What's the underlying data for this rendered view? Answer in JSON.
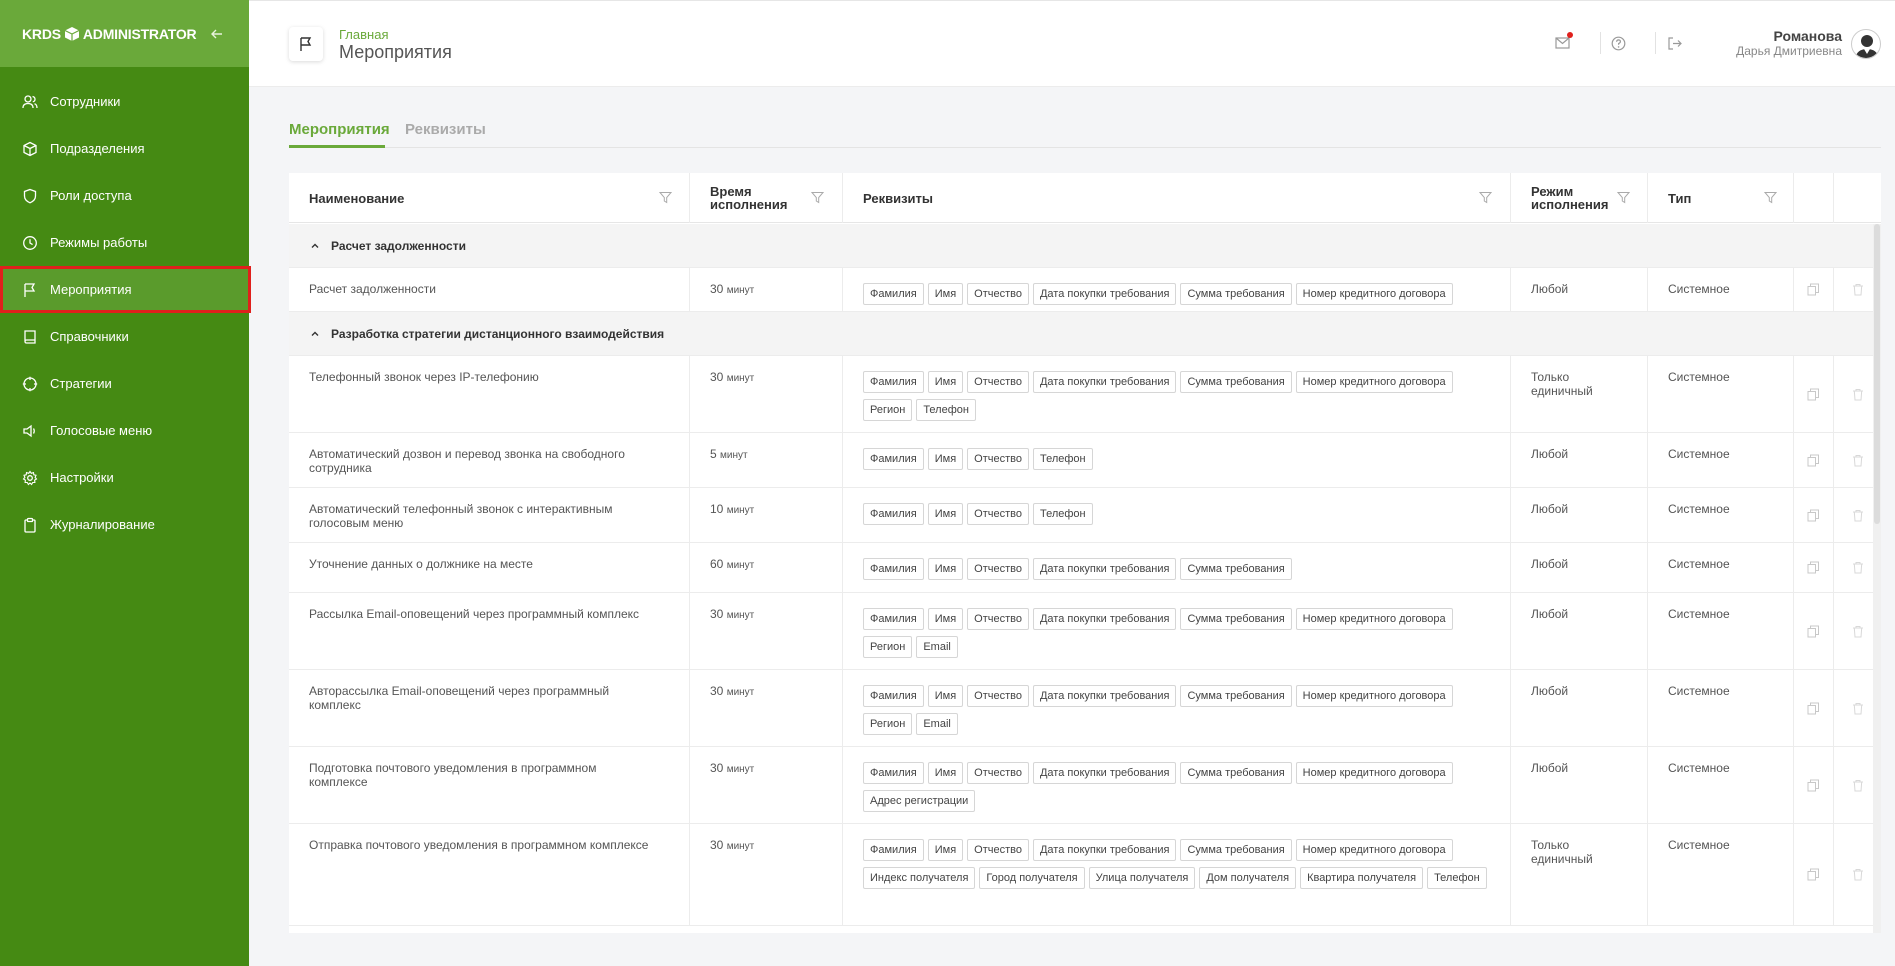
{
  "sidebar": {
    "logo_left": "KRDS",
    "logo_right": "ADMINISTRATOR",
    "items": [
      {
        "label": "Сотрудники",
        "icon": "users-icon"
      },
      {
        "label": "Подразделения",
        "icon": "cube-icon"
      },
      {
        "label": "Роли доступа",
        "icon": "shield-icon"
      },
      {
        "label": "Режимы работы",
        "icon": "clock-icon"
      },
      {
        "label": "Мероприятия",
        "icon": "flag-icon",
        "active": true
      },
      {
        "label": "Справочники",
        "icon": "book-icon"
      },
      {
        "label": "Стратегии",
        "icon": "crosshair-icon"
      },
      {
        "label": "Голосовые меню",
        "icon": "speaker-icon"
      },
      {
        "label": "Настройки",
        "icon": "gear-icon"
      },
      {
        "label": "Журналирование",
        "icon": "clipboard-icon"
      }
    ]
  },
  "header": {
    "breadcrumb": "Главная",
    "title": "Мероприятия",
    "user": {
      "last_name": "Романова",
      "first_names": "Дарья Дмитриевна"
    }
  },
  "tabs": [
    {
      "label": "Мероприятия",
      "active": true
    },
    {
      "label": "Реквизиты",
      "active": false
    }
  ],
  "table": {
    "columns": {
      "name": "Наименование",
      "time_l1": "Время",
      "time_l2": "исполнения",
      "req": "Реквизиты",
      "mode_l1": "Режим",
      "mode_l2": "исполнения",
      "type": "Тип"
    },
    "groups": [
      {
        "title": "Расчет задолженности",
        "rows": [
          {
            "name": [
              "Расчет задолженности"
            ],
            "time": "30",
            "unit": "минут",
            "req": [
              "Фамилия",
              "Имя",
              "Отчество",
              "Дата покупки требования",
              "Сумма требования",
              "Номер кредитного договора"
            ],
            "mode": [
              "Любой"
            ],
            "type": "Системное"
          }
        ]
      },
      {
        "title": "Разработка стратегии дистанционного взаимодействия",
        "rows": [
          {
            "name": [
              "Телефонный звонок через IP-телефонию"
            ],
            "time": "30",
            "unit": "минут",
            "req": [
              "Фамилия",
              "Имя",
              "Отчество",
              "Дата покупки требования",
              "Сумма требования",
              "Номер кредитного договора",
              "Регион",
              "Телефон"
            ],
            "mode": [
              "Только",
              "единичный"
            ],
            "type": "Системное"
          },
          {
            "name": [
              "Автоматический дозвон и перевод звонка на свободного",
              "сотрудника"
            ],
            "time": "5",
            "unit": "минут",
            "req": [
              "Фамилия",
              "Имя",
              "Отчество",
              "Телефон"
            ],
            "mode": [
              "Любой"
            ],
            "type": "Системное"
          },
          {
            "name": [
              "Автоматический телефонный звонок с интерактивным",
              "голосовым меню"
            ],
            "time": "10",
            "unit": "минут",
            "req": [
              "Фамилия",
              "Имя",
              "Отчество",
              "Телефон"
            ],
            "mode": [
              "Любой"
            ],
            "type": "Системное"
          },
          {
            "name": [
              "Уточнение данных о должнике на месте"
            ],
            "time": "60",
            "unit": "минут",
            "req": [
              "Фамилия",
              "Имя",
              "Отчество",
              "Дата покупки требования",
              "Сумма требования"
            ],
            "mode": [
              "Любой"
            ],
            "type": "Системное"
          },
          {
            "name": [
              "Рассылка Email-оповещений через программный комплекс"
            ],
            "time": "30",
            "unit": "минут",
            "req": [
              "Фамилия",
              "Имя",
              "Отчество",
              "Дата покупки требования",
              "Сумма требования",
              "Номер кредитного договора",
              "Регион",
              "Email"
            ],
            "mode": [
              "Любой"
            ],
            "type": "Системное"
          },
          {
            "name": [
              "Авторассылка Email-оповещений через программный",
              "комплекс"
            ],
            "time": "30",
            "unit": "минут",
            "req": [
              "Фамилия",
              "Имя",
              "Отчество",
              "Дата покупки требования",
              "Сумма требования",
              "Номер кредитного договора",
              "Регион",
              "Email"
            ],
            "mode": [
              "Любой"
            ],
            "type": "Системное"
          },
          {
            "name": [
              "Подготовка почтового уведомления в программном",
              "комплексе"
            ],
            "time": "30",
            "unit": "минут",
            "req": [
              "Фамилия",
              "Имя",
              "Отчество",
              "Дата покупки требования",
              "Сумма требования",
              "Номер кредитного договора",
              "Адрес регистрации"
            ],
            "mode": [
              "Любой"
            ],
            "type": "Системное"
          },
          {
            "name": [
              "Отправка почтового уведомления в программном комплексе"
            ],
            "time": "30",
            "unit": "минут",
            "req": [
              "Фамилия",
              "Имя",
              "Отчество",
              "Дата покупки требования",
              "Сумма требования",
              "Номер кредитного договора",
              "Индекс получателя",
              "Город получателя",
              "Улица получателя",
              "Дом получателя",
              "Квартира получателя",
              "Телефон"
            ],
            "mode": [
              "Только",
              "единичный"
            ],
            "type": "Системное"
          }
        ]
      }
    ]
  },
  "colors": {
    "sidebar": "#458a13",
    "sidebar_header": "#6aa93a",
    "accent": "#6aa93a",
    "highlight": "#e0201c"
  }
}
